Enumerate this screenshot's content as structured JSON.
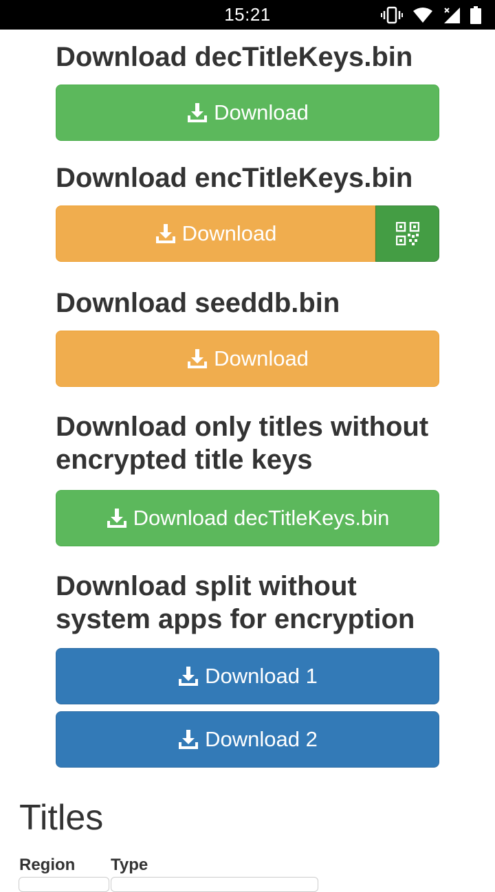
{
  "status_bar": {
    "time": "15:21",
    "icons": [
      "vibrate-icon",
      "wifi-icon",
      "signal-icon",
      "battery-icon"
    ]
  },
  "sections": [
    {
      "title": "Download decTitleKeys.bin",
      "button_label": "Download",
      "color": "#5cb85c"
    },
    {
      "title": "Download encTitleKeys.bin",
      "button_label": "Download",
      "color": "#f0ad4e",
      "qr": "qr-code-icon"
    },
    {
      "title": "Download seeddb.bin",
      "button_label": "Download",
      "color": "#f0ad4e"
    },
    {
      "title": "Download only titles without encrypted title keys",
      "button_label": "Download decTitleKeys.bin",
      "color": "#5cb85c"
    },
    {
      "title": "Download split without system apps for encryption",
      "buttons": [
        "Download 1",
        "Download 2"
      ],
      "color": "#337ab7"
    }
  ],
  "titles": {
    "heading": "Titles",
    "columns": [
      "Region",
      "Type"
    ]
  }
}
